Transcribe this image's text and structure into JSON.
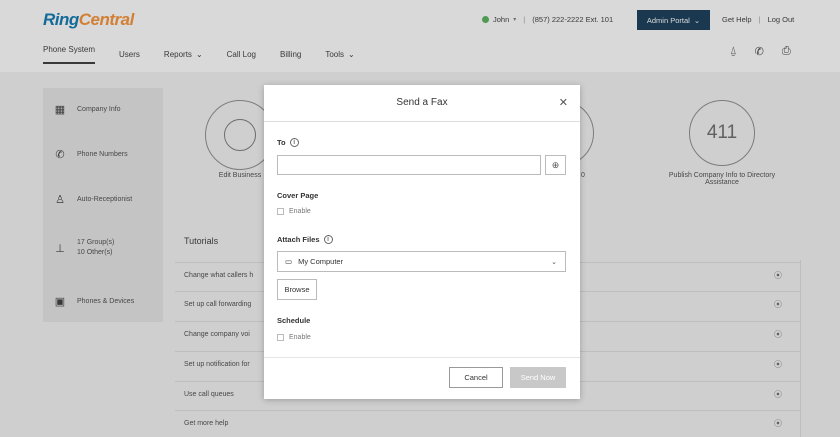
{
  "app": {
    "logo_part1": "Ring",
    "logo_part2": "Central"
  },
  "header": {
    "user_name": "John",
    "phone": "(857) 222-2222 Ext. 101",
    "admin_portal_label": "Admin Portal",
    "get_help": "Get Help",
    "log_out": "Log Out",
    "separator": "|"
  },
  "nav": {
    "items": [
      {
        "label": "Phone System"
      },
      {
        "label": "Users"
      },
      {
        "label": "Reports"
      },
      {
        "label": "Call Log"
      },
      {
        "label": "Billing"
      },
      {
        "label": "Tools"
      }
    ]
  },
  "sidebar": {
    "items": [
      {
        "label": "Company Info",
        "icon": "building-icon"
      },
      {
        "label": "Phone Numbers",
        "icon": "phone-icon"
      },
      {
        "label": "Auto-Receptionist",
        "icon": "person-icon"
      },
      {
        "label": "17 Group(s)",
        "label2": "10 Other(s)",
        "icon": "org-chart-icon"
      },
      {
        "label": "Phones & Devices",
        "icon": "device-icon"
      }
    ]
  },
  "dashboard": {
    "card_left_label": "Edit Business",
    "card_mid_label": "0",
    "card_right_number": "411",
    "card_right_label": "Publish Company Info to Directory Assistance",
    "tutorials_title": "Tutorials",
    "tutorials": [
      {
        "label": "Change what callers h"
      },
      {
        "label": "Set up call forwarding"
      },
      {
        "label": "Change company voi"
      },
      {
        "label": "Set up notification for"
      },
      {
        "label": "Use call queues"
      },
      {
        "label": "Get more help"
      }
    ]
  },
  "modal": {
    "title": "Send a Fax",
    "to_label": "To",
    "cover_page_label": "Cover Page",
    "cover_enable": "Enable",
    "attach_files_label": "Attach Files",
    "attach_source": "My Computer",
    "browse_label": "Browse",
    "schedule_label": "Schedule",
    "schedule_enable": "Enable",
    "cancel_label": "Cancel",
    "send_label": "Send Now"
  },
  "colors": {
    "brand_blue": "#0073ae",
    "brand_orange": "#f68d2e",
    "admin_button": "#0b3350",
    "status_green": "#4caf50"
  }
}
